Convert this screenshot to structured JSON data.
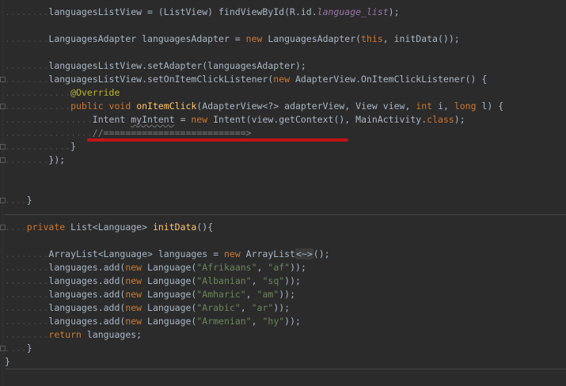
{
  "editor": {
    "lines": {
      "l1": {
        "dots": "........",
        "a": "languagesListView",
        "b": " = (ListView) findViewById(R.id.",
        "c": "language_list",
        "d": ");"
      },
      "l2": {
        "dots": "........",
        "a": "LanguagesAdapter languagesAdapter = ",
        "kw": "new",
        "b": " LanguagesAdapter(",
        "kw2": "this",
        "c": ", initData());"
      },
      "l3": {
        "dots": "........",
        "a": "languagesListView.setAdapter(languagesAdapter);"
      },
      "l4": {
        "dots": "........",
        "a": "languagesListView.setOnItemClickListener(",
        "kw": "new",
        "b": " AdapterView.OnItemClickListener() {"
      },
      "l5": {
        "dots": "............",
        "ann": "@Override"
      },
      "l6": {
        "dots": "............",
        "kw": "public void",
        "sp": " ",
        "fn": "onItemClick",
        "a": "(AdapterView<?> adapterView, View view, ",
        "kw2": "int",
        "b": " i, ",
        "kw3": "long",
        "c": " l) {"
      },
      "l7": {
        "dots": "................",
        "a": "Intent ",
        "unused": "myIntent",
        "b": " = ",
        "kw": "new",
        "c": " Intent(view.getContext(), MainActivity.",
        "kw2": "class",
        "d": ");"
      },
      "l8": {
        "dots": "................",
        "comment": "//==========================>"
      },
      "l9": {
        "dots": "............",
        "a": "}"
      },
      "l10": {
        "dots": "........",
        "a": "});"
      },
      "l11": {
        "dots": "....",
        "a": "}"
      },
      "l12": {
        "dots": "....",
        "kw": "private",
        "a": " List<Language> ",
        "fn": "initData",
        "b": "(){"
      },
      "l13": {
        "dots": "........",
        "a": "ArrayList<Language> languages = ",
        "kw": "new",
        "b": " ArrayList",
        "hint": "<~>",
        "c": "();"
      },
      "l14": {
        "dots": "........",
        "a": "languages.add(",
        "kw": "new",
        "b": " Language(",
        "s1": "\"Afrikaans\"",
        "c": ", ",
        "s2": "\"af\"",
        "d": "));"
      },
      "l15": {
        "dots": "........",
        "a": "languages.add(",
        "kw": "new",
        "b": " Language(",
        "s1": "\"Albanian\"",
        "c": ", ",
        "s2": "\"sq\"",
        "d": "));"
      },
      "l16": {
        "dots": "........",
        "a": "languages.add(",
        "kw": "new",
        "b": " Language(",
        "s1": "\"Amharic\"",
        "c": ", ",
        "s2": "\"am\"",
        "d": "));"
      },
      "l17": {
        "dots": "........",
        "a": "languages.add(",
        "kw": "new",
        "b": " Language(",
        "s1": "\"Arabic\"",
        "c": ", ",
        "s2": "\"ar\"",
        "d": "));"
      },
      "l18": {
        "dots": "........",
        "a": "languages.add(",
        "kw": "new",
        "b": " Language(",
        "s1": "\"Armenian\"",
        "c": ", ",
        "s2": "\"hy\"",
        "d": "));"
      },
      "l19": {
        "dots": "........",
        "kw": "return",
        "a": " languages;"
      },
      "l20": {
        "dots": "....",
        "a": "}"
      },
      "l21": {
        "dots": "",
        "a": "}"
      }
    },
    "colors": {
      "background": "#2b2b2b",
      "keyword": "#cc7832",
      "method": "#ffc66d",
      "string": "#6a8759",
      "annotation": "#bbb529",
      "field": "#9876aa",
      "comment": "#808080",
      "highlight_mark": "#c01515"
    }
  }
}
